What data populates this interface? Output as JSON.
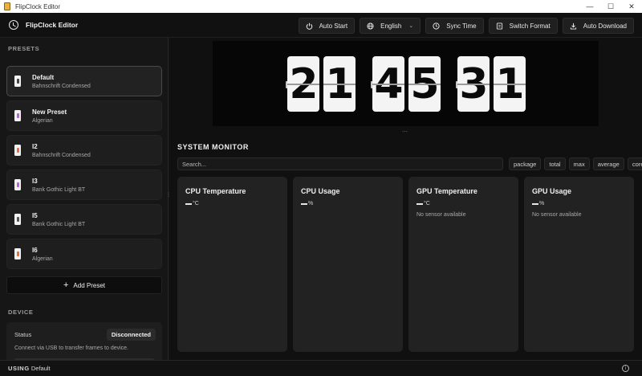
{
  "window": {
    "title": "FlipClock Editor",
    "controls": {
      "minimize": "—",
      "maximize": "☐",
      "close": "✕"
    }
  },
  "header": {
    "title": "FlipClock Editor",
    "logo_icon": "clock-icon",
    "buttons": {
      "auto_start": "Auto Start",
      "language": "English",
      "sync_time": "Sync Time",
      "switch_format": "Switch Format",
      "auto_download": "Auto Download"
    }
  },
  "sidebar": {
    "presets_label": "PRESETS",
    "presets": [
      {
        "name": "Default",
        "font": "Bahnschrift Condensed",
        "accent": "#444444"
      },
      {
        "name": "New Preset",
        "font": "Algerian",
        "accent": "#c060e0"
      },
      {
        "name": "I2",
        "font": "Bahnschrift Condensed",
        "accent": "#e87040"
      },
      {
        "name": "I3",
        "font": "Bank Gothic Light BT",
        "accent": "#c060e0"
      },
      {
        "name": "I5",
        "font": "Bank Gothic Light BT",
        "accent": "#555555"
      },
      {
        "name": "I6",
        "font": "Algerian",
        "accent": "#e87040"
      }
    ],
    "add_preset_label": "Add Preset",
    "device_label": "DEVICE",
    "device": {
      "status_label": "Status",
      "status_value": "Disconnected",
      "hint": "Connect via USB to transfer frames to device."
    }
  },
  "clock": {
    "digits": [
      "2",
      "1",
      "4",
      "5",
      "3",
      "1"
    ]
  },
  "monitor": {
    "title": "SYSTEM MONITOR",
    "search_placeholder": "Search...",
    "filters": [
      "package",
      "total",
      "max",
      "average",
      "core"
    ],
    "sensors": [
      {
        "title": "CPU Temperature",
        "unit": "°C",
        "note": ""
      },
      {
        "title": "CPU Usage",
        "unit": "%",
        "note": ""
      },
      {
        "title": "GPU Temperature",
        "unit": "°C",
        "note": "No sensor available"
      },
      {
        "title": "GPU Usage",
        "unit": "%",
        "note": "No sensor available"
      }
    ]
  },
  "footer": {
    "using_label": "USING",
    "using_value": "Default",
    "info_icon": "info-icon"
  }
}
